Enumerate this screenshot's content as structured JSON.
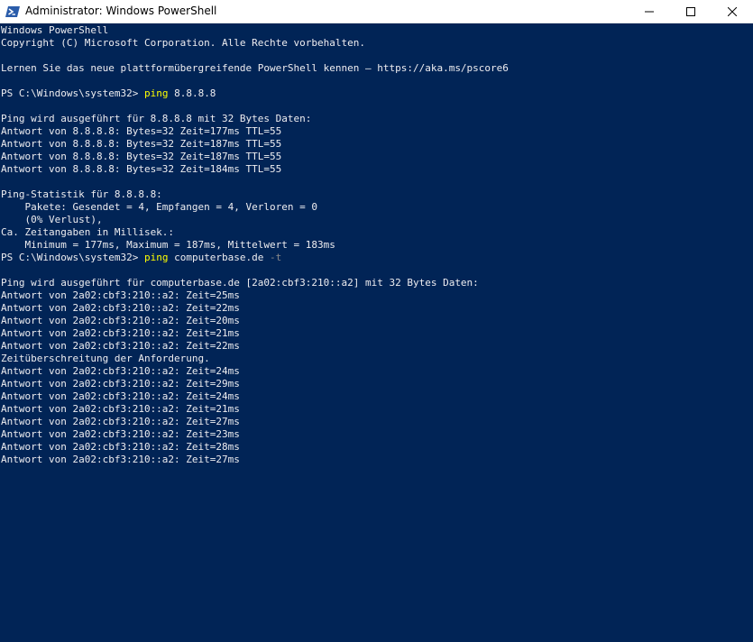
{
  "window": {
    "title": "Administrator: Windows PowerShell",
    "icon": "powershell-icon",
    "controls": [
      "minimize-icon",
      "maximize-icon",
      "close-icon"
    ]
  },
  "colors": {
    "console_background": "#012456",
    "console_text": "#EEEDF0",
    "command_text": "#FFFF00",
    "parameter_text": "#8A8A8A"
  },
  "console": {
    "lines": [
      {
        "text": "Windows PowerShell"
      },
      {
        "text": "Copyright (C) Microsoft Corporation. Alle Rechte vorbehalten."
      },
      {
        "text": ""
      },
      {
        "text": "Lernen Sie das neue plattformübergreifende PowerShell kennen – https://aka.ms/pscore6"
      },
      {
        "text": ""
      },
      {
        "prompt": "PS C:\\Windows\\system32> ",
        "command": "ping",
        "args": " 8.8.8.8",
        "flag": ""
      },
      {
        "text": ""
      },
      {
        "text": "Ping wird ausgeführt für 8.8.8.8 mit 32 Bytes Daten:"
      },
      {
        "text": "Antwort von 8.8.8.8: Bytes=32 Zeit=177ms TTL=55"
      },
      {
        "text": "Antwort von 8.8.8.8: Bytes=32 Zeit=187ms TTL=55"
      },
      {
        "text": "Antwort von 8.8.8.8: Bytes=32 Zeit=187ms TTL=55"
      },
      {
        "text": "Antwort von 8.8.8.8: Bytes=32 Zeit=184ms TTL=55"
      },
      {
        "text": ""
      },
      {
        "text": "Ping-Statistik für 8.8.8.8:"
      },
      {
        "text": "    Pakete: Gesendet = 4, Empfangen = 4, Verloren = 0"
      },
      {
        "text": "    (0% Verlust),"
      },
      {
        "text": "Ca. Zeitangaben in Millisek.:"
      },
      {
        "text": "    Minimum = 177ms, Maximum = 187ms, Mittelwert = 183ms"
      },
      {
        "prompt": "PS C:\\Windows\\system32> ",
        "command": "ping",
        "args": " computerbase.de ",
        "flag": "-t"
      },
      {
        "text": ""
      },
      {
        "text": "Ping wird ausgeführt für computerbase.de [2a02:cbf3:210::a2] mit 32 Bytes Daten:"
      },
      {
        "text": "Antwort von 2a02:cbf3:210::a2: Zeit=25ms"
      },
      {
        "text": "Antwort von 2a02:cbf3:210::a2: Zeit=22ms"
      },
      {
        "text": "Antwort von 2a02:cbf3:210::a2: Zeit=20ms"
      },
      {
        "text": "Antwort von 2a02:cbf3:210::a2: Zeit=21ms"
      },
      {
        "text": "Antwort von 2a02:cbf3:210::a2: Zeit=22ms"
      },
      {
        "text": "Zeitüberschreitung der Anforderung."
      },
      {
        "text": "Antwort von 2a02:cbf3:210::a2: Zeit=24ms"
      },
      {
        "text": "Antwort von 2a02:cbf3:210::a2: Zeit=29ms"
      },
      {
        "text": "Antwort von 2a02:cbf3:210::a2: Zeit=24ms"
      },
      {
        "text": "Antwort von 2a02:cbf3:210::a2: Zeit=21ms"
      },
      {
        "text": "Antwort von 2a02:cbf3:210::a2: Zeit=27ms"
      },
      {
        "text": "Antwort von 2a02:cbf3:210::a2: Zeit=23ms"
      },
      {
        "text": "Antwort von 2a02:cbf3:210::a2: Zeit=28ms"
      },
      {
        "text": "Antwort von 2a02:cbf3:210::a2: Zeit=27ms"
      }
    ]
  }
}
